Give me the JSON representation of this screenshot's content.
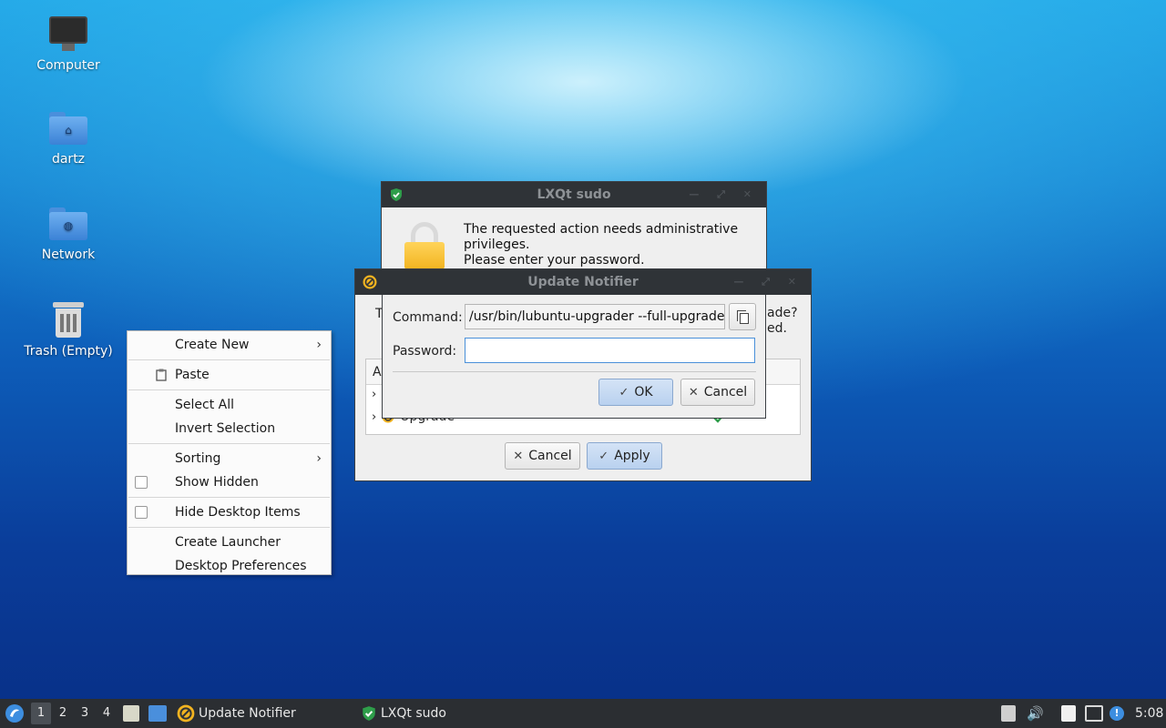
{
  "desktop": {
    "icons": [
      {
        "label": "Computer",
        "icon": "computer-icon"
      },
      {
        "label": "dartz",
        "icon": "home-folder-icon"
      },
      {
        "label": "Network",
        "icon": "network-folder-icon"
      },
      {
        "label": "Trash (Empty)",
        "icon": "trash-icon"
      }
    ]
  },
  "context_menu": {
    "create_new": "Create New",
    "paste": "Paste",
    "select_all": "Select All",
    "invert_selection": "Invert Selection",
    "sorting": "Sorting",
    "show_hidden": "Show Hidden",
    "hide_desktop_items": "Hide Desktop Items",
    "create_launcher": "Create Launcher",
    "desktop_preferences": "Desktop Preferences"
  },
  "sudo_window": {
    "title": "LXQt sudo",
    "message_line1": "The requested action needs administrative",
    "message_line2": "privileges.",
    "message_line3": "Please enter your password.",
    "command_label": "Command:",
    "command_value": "/usr/bin/lubuntu-upgrader --full-upgrade",
    "password_label": "Password:",
    "password_value": "",
    "ok_label": "OK",
    "cancel_label": "Cancel"
  },
  "update_window": {
    "title": "Update Notifier",
    "partial_text_left": "T",
    "partial_text_right1": "ade?",
    "partial_text_right2": "ed.",
    "list_header": "A",
    "row_upgrade": "Upgrade",
    "cancel_label": "Cancel",
    "apply_label": "Apply"
  },
  "taskbar": {
    "workspaces": [
      "1",
      "2",
      "3",
      "4"
    ],
    "active_workspace": "1",
    "tasks": [
      {
        "label": "Update Notifier",
        "icon": "update-notifier-icon"
      },
      {
        "label": "LXQt sudo",
        "icon": "shield-icon"
      }
    ],
    "clock": "5:08"
  },
  "colors": {
    "accent": "#4a90d9",
    "titlebar": "#2f3337",
    "taskbar": "#2b2e32",
    "shield_green": "#2e9e4a",
    "lock_gold": "#f2b320"
  }
}
